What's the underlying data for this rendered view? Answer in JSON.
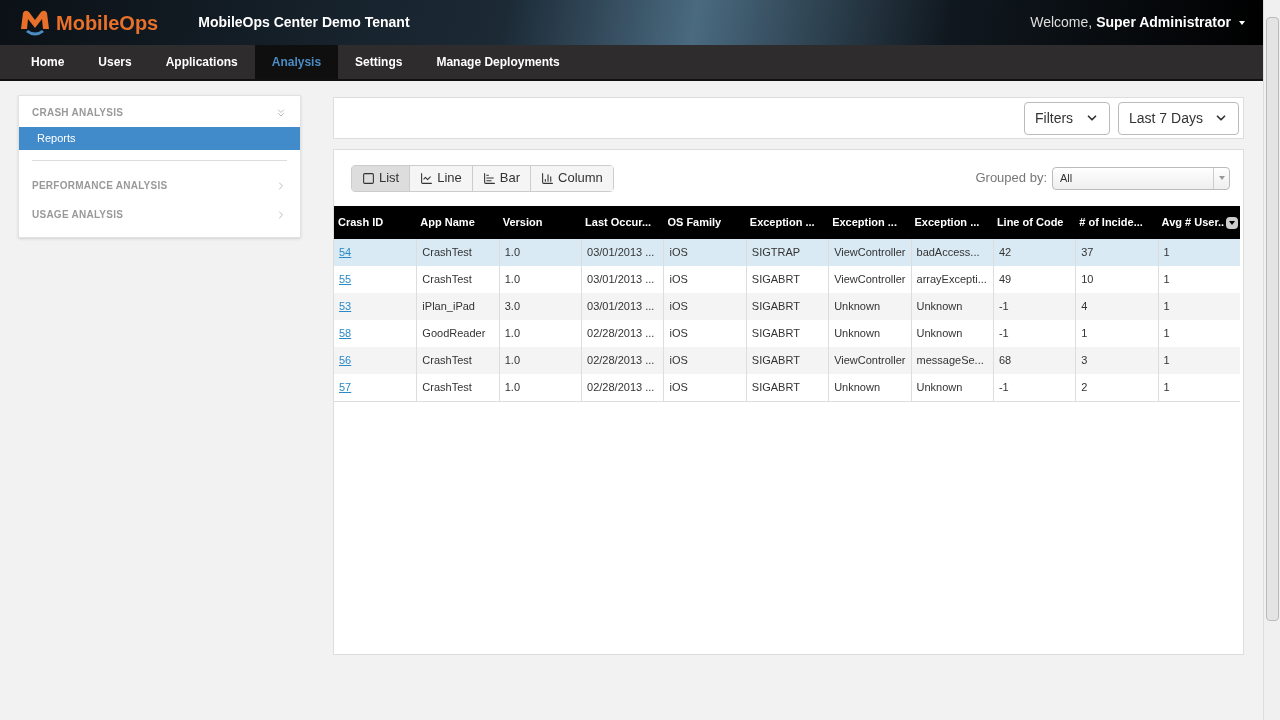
{
  "header": {
    "logo": "MobileOps",
    "tenant": "MobileOps Center Demo Tenant",
    "welcome": "Welcome,",
    "user": "Super Administrator"
  },
  "nav": [
    {
      "label": "Home",
      "selected": false
    },
    {
      "label": "Users",
      "selected": false
    },
    {
      "label": "Applications",
      "selected": false
    },
    {
      "label": "Analysis",
      "selected": true
    },
    {
      "label": "Settings",
      "selected": false
    },
    {
      "label": "Manage Deployments",
      "selected": false
    }
  ],
  "sidebar": [
    {
      "label": "CRASH ANALYSIS",
      "expanded": true,
      "children": [
        {
          "label": "Reports",
          "selected": true
        }
      ]
    },
    {
      "label": "PERFORMANCE ANALYSIS",
      "expanded": false
    },
    {
      "label": "USAGE ANALYSIS",
      "expanded": false
    }
  ],
  "toolbar": {
    "filters": "Filters",
    "range": "Last 7 Days"
  },
  "views": [
    {
      "label": "List",
      "kind": "list",
      "selected": true
    },
    {
      "label": "Line",
      "kind": "line",
      "selected": false
    },
    {
      "label": "Bar",
      "kind": "bar",
      "selected": false
    },
    {
      "label": "Column",
      "kind": "column",
      "selected": false
    }
  ],
  "grouped_by": {
    "label": "Grouped by:",
    "value": "All"
  },
  "table": {
    "columns": [
      "Crash ID",
      "App Name",
      "Version",
      "Last Occur...",
      "OS Family",
      "Exception ...",
      "Exception ...",
      "Exception ...",
      "Line of Code",
      "# of Incide...",
      "Avg # User.."
    ],
    "rows": [
      {
        "selected": true,
        "cells": [
          "54",
          "CrashTest",
          "1.0",
          "03/01/2013 ...",
          "iOS",
          "SIGTRAP",
          "ViewController",
          "badAccess...",
          "42",
          "37",
          "1"
        ]
      },
      {
        "selected": false,
        "cells": [
          "55",
          "CrashTest",
          "1.0",
          "03/01/2013 ...",
          "iOS",
          "SIGABRT",
          "ViewController",
          "arrayExcepti...",
          "49",
          "10",
          "1"
        ]
      },
      {
        "selected": false,
        "cells": [
          "53",
          "iPlan_iPad",
          "3.0",
          "03/01/2013 ...",
          "iOS",
          "SIGABRT",
          "Unknown",
          "Unknown",
          "-1",
          "4",
          "1"
        ]
      },
      {
        "selected": false,
        "cells": [
          "58",
          "GoodReader",
          "1.0",
          "02/28/2013 ...",
          "iOS",
          "SIGABRT",
          "Unknown",
          "Unknown",
          "-1",
          "1",
          "1"
        ]
      },
      {
        "selected": false,
        "cells": [
          "56",
          "CrashTest",
          "1.0",
          "02/28/2013 ...",
          "iOS",
          "SIGABRT",
          "ViewController",
          "messageSe...",
          "68",
          "3",
          "1"
        ]
      },
      {
        "selected": false,
        "cells": [
          "57",
          "CrashTest",
          "1.0",
          "02/28/2013 ...",
          "iOS",
          "SIGABRT",
          "Unknown",
          "Unknown",
          "-1",
          "2",
          "1"
        ]
      }
    ]
  }
}
